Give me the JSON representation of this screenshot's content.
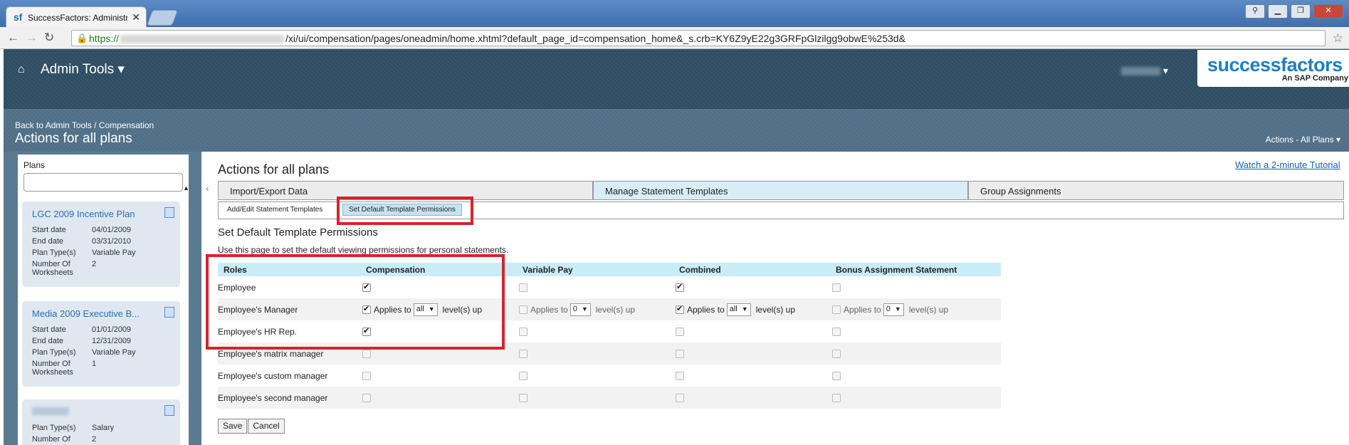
{
  "browser": {
    "tab_title": "SuccessFactors: Administr",
    "url_prefix": "https://",
    "url_path": "/xi/ui/compensation/pages/oneadmin/home.xhtml?default_page_id=compensation_home&_s.crb=KY6Z9yE22g3GRFpGlzilgg9obwE%253d&"
  },
  "header": {
    "admin_tools": "Admin Tools ▾",
    "logo_text": "successfactors",
    "logo_sub": "An SAP Company"
  },
  "subheader": {
    "breadcrumb": "Back to Admin Tools / Compensation",
    "title": "Actions for all plans",
    "actions_menu": "Actions - All Plans ▾"
  },
  "sidebar": {
    "label": "Plans",
    "plans": [
      {
        "name": "LGC 2009 Incentive Plan",
        "rows": [
          [
            "Start date",
            "04/01/2009"
          ],
          [
            "End date",
            "03/31/2010"
          ],
          [
            "Plan Type(s)",
            "Variable Pay"
          ],
          [
            "Number Of Worksheets",
            "2"
          ]
        ]
      },
      {
        "name": "Media 2009 Executive B...",
        "rows": [
          [
            "Start date",
            "01/01/2009"
          ],
          [
            "End date",
            "12/31/2009"
          ],
          [
            "Plan Type(s)",
            "Variable Pay"
          ],
          [
            "Number Of Worksheets",
            "1"
          ]
        ]
      },
      {
        "name": "",
        "rows": [
          [
            "Plan Type(s)",
            "Salary"
          ],
          [
            "Number Of",
            "2"
          ]
        ]
      }
    ]
  },
  "main": {
    "title": "Actions for all plans",
    "tutorial": "Watch a 2-minute Tutorial",
    "tabs": [
      "Import/Export Data",
      "Manage Statement Templates",
      "Group Assignments"
    ],
    "subtabs": [
      "Add/Edit Statement Templates",
      "Set Default Template Permissions"
    ],
    "section_title": "Set Default Template Permissions",
    "section_desc": "Use this page to set the default viewing permissions for personal statements.",
    "columns": [
      "Roles",
      "Compensation",
      "Variable Pay",
      "Combined",
      "Bonus Assignment Statement"
    ],
    "roles": [
      "Employee",
      "Employee's Manager",
      "Employee's HR Rep.",
      "Employee's matrix manager",
      "Employee's custom manager",
      "Employee's second manager"
    ],
    "applies_to": "Applies to",
    "levels_up": "level(s) up",
    "sel_all": "all",
    "sel_zero": "0",
    "save": "Save",
    "cancel": "Cancel"
  }
}
